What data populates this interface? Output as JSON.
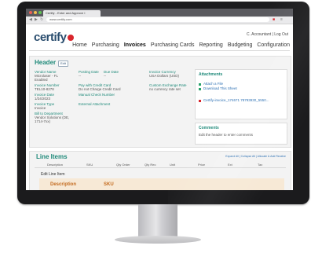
{
  "browser": {
    "tab_title": "Certify - Enter and Approve I",
    "address": "www.certify.com",
    "colors": {
      "close": "#ec5f55",
      "min": "#f4bf4f",
      "max": "#61c554"
    }
  },
  "app": {
    "logo": "certify",
    "user_line": "C. Accountant | Log Out",
    "nav": [
      "Home",
      "Purchasing",
      "Invoices",
      "Purchasing Cards",
      "Reporting",
      "Budgeting",
      "Configuration"
    ],
    "active_nav": "Invoices"
  },
  "header": {
    "title": "Header",
    "edit_label": "Edit",
    "vendor_name_label": "Vendor Name",
    "vendor_name_value": "Microlaser - FL",
    "vendor_status": "Enabled",
    "invoice_number_label": "Invoice Number",
    "invoice_number_value": "TEL10-8278",
    "invoice_date_label": "Invoice Date",
    "invoice_date_value": "1/24/2023",
    "invoice_type_label": "Invoice Type",
    "invoice_type_value": "Invoice",
    "bill_to_label": "Bill to Department",
    "bill_to_value": "Vendor Solutions (DE, 1714-7xx)",
    "posting_date_label": "Posting Date",
    "posting_date_value": "--",
    "due_date_label": "Due Date",
    "due_date_value": "--",
    "pay_with_label": "Pay with Credit Card",
    "pay_with_value": "Do not Charge Credit Card",
    "manual_check_label": "Manual Check Number",
    "external_attachment_label": "External Attachment",
    "invoice_currency_label": "Invoice Currency",
    "invoice_currency_value": "USA Dollars (USD)",
    "custom_exchange_label": "Custom Exchange Rate",
    "custom_exchange_value": "no currency rate set"
  },
  "attachments": {
    "title": "Attachments",
    "items": [
      "Attach a File",
      "Download This Sheet"
    ],
    "file_name": "Certify-invoice_174671 78793930_5550..."
  },
  "comments": {
    "title": "Comments",
    "placeholder": "Edit the header to enter comments"
  },
  "line_items": {
    "title": "Line Items",
    "links": "Expand All  |  Collapse All  |  Allocate & Add Receive",
    "columns": [
      "Description",
      "SKU",
      "Qty Order",
      "Qty Rec",
      "Unit",
      "Price",
      "Ext",
      "Tax"
    ],
    "edit_row_label": "Edit Line Item",
    "edit_description": "Description",
    "edit_sku": "SKU"
  }
}
